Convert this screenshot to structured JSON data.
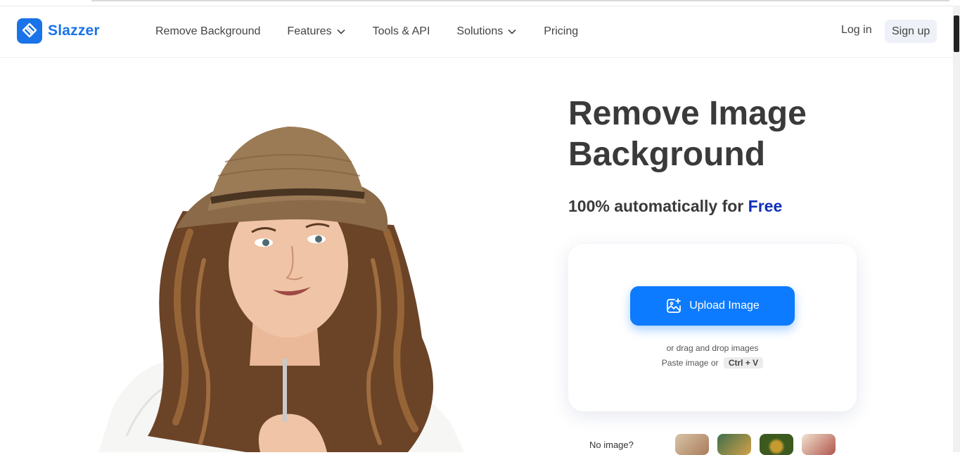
{
  "brand": {
    "name": "Slazzer",
    "color": "#1a73e8"
  },
  "nav": {
    "items": [
      {
        "label": "Remove Background",
        "has_dropdown": false
      },
      {
        "label": "Features",
        "has_dropdown": true
      },
      {
        "label": "Tools & API",
        "has_dropdown": false
      },
      {
        "label": "Solutions",
        "has_dropdown": true
      },
      {
        "label": "Pricing",
        "has_dropdown": false
      }
    ],
    "login": "Log in",
    "signup": "Sign up"
  },
  "hero": {
    "title": "Remove Image Background",
    "subtitle_prefix": "100% automatically for",
    "subtitle_highlight": "Free"
  },
  "upload": {
    "button": "Upload Image",
    "drag_text": "or drag and drop images",
    "paste_text": "Paste image or",
    "shortcut": "Ctrl + V",
    "icon": "image-sparkle-icon"
  },
  "samples": {
    "label": "No image?",
    "thumbnails": [
      "sample-thumb-couple",
      "sample-thumb-group",
      "sample-thumb-green",
      "sample-thumb-portrait"
    ]
  },
  "colors": {
    "accent": "#0d7bff",
    "free": "#1030b8",
    "text": "#3a3a3a"
  }
}
